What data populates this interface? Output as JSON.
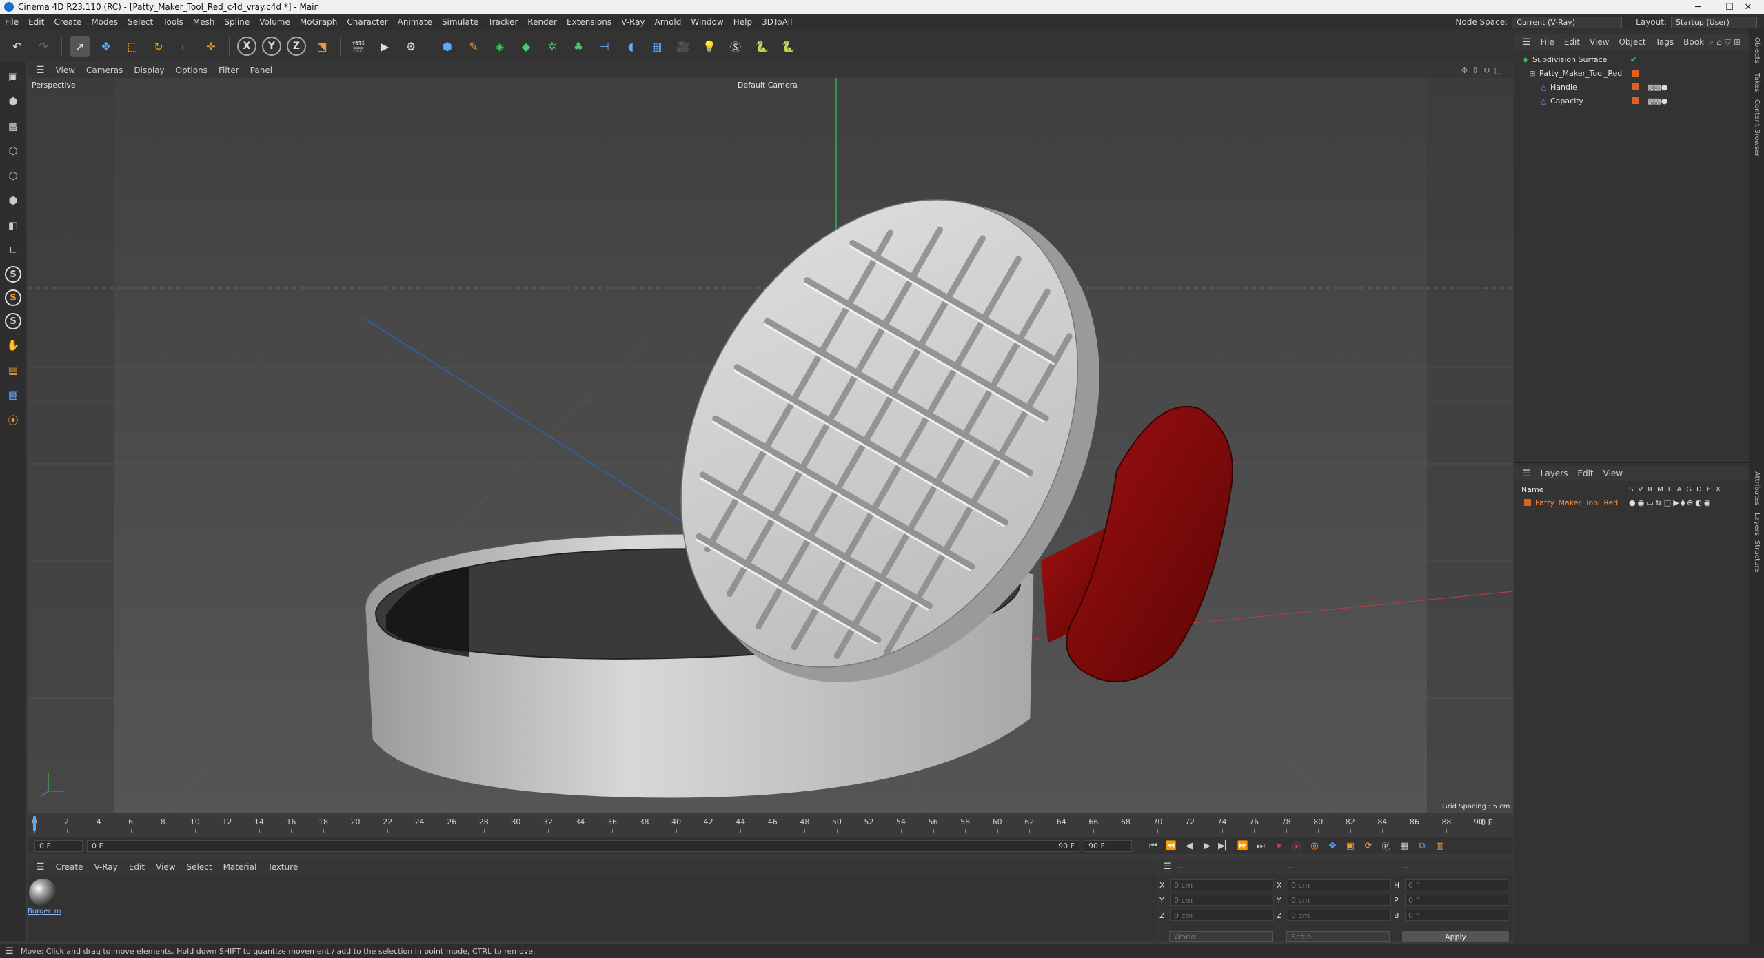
{
  "titlebar": {
    "title": "Cinema 4D R23.110 (RC) - [Patty_Maker_Tool_Red_c4d_vray.c4d *] - Main",
    "minimize": "─",
    "maximize": "☐",
    "close": "✕"
  },
  "menu": {
    "items": [
      "File",
      "Edit",
      "Create",
      "Modes",
      "Select",
      "Tools",
      "Mesh",
      "Spline",
      "Volume",
      "MoGraph",
      "Character",
      "Animate",
      "Simulate",
      "Tracker",
      "Render",
      "Extensions",
      "V-Ray",
      "Arnold",
      "Window",
      "Help",
      "3DToAll"
    ],
    "node_space_label": "Node Space:",
    "node_space_value": "Current (V-Ray)",
    "layout_label": "Layout:",
    "layout_value": "Startup (User)"
  },
  "viewport": {
    "menu": [
      "View",
      "Cameras",
      "Display",
      "Options",
      "Filter",
      "Panel"
    ],
    "view_name": "Perspective",
    "camera": "Default Camera",
    "grid_spacing": "Grid Spacing : 5 cm"
  },
  "timeline": {
    "ticks": [
      "0",
      "2",
      "4",
      "6",
      "8",
      "10",
      "12",
      "14",
      "16",
      "18",
      "20",
      "22",
      "24",
      "26",
      "28",
      "30",
      "32",
      "34",
      "36",
      "38",
      "40",
      "42",
      "44",
      "46",
      "48",
      "50",
      "52",
      "54",
      "56",
      "58",
      "60",
      "62",
      "64",
      "66",
      "68",
      "70",
      "72",
      "74",
      "76",
      "78",
      "80",
      "82",
      "84",
      "86",
      "88",
      "90"
    ],
    "current_frame_right": "0 F",
    "start_field": "0 F",
    "range_start": "0 F",
    "range_end": "90 F",
    "end_field": "90 F"
  },
  "material_manager": {
    "menu": [
      "Create",
      "V-Ray",
      "Edit",
      "View",
      "Select",
      "Material",
      "Texture"
    ],
    "materials": [
      {
        "name": "Burger_m"
      }
    ]
  },
  "coordinates": {
    "header_left": "--",
    "header_mid": "--",
    "header_right": "--",
    "rows": [
      {
        "a": "X",
        "av": "0 cm",
        "b": "X",
        "bv": "0 cm",
        "c": "H",
        "cv": "0 °"
      },
      {
        "a": "Y",
        "av": "0 cm",
        "b": "Y",
        "bv": "0 cm",
        "c": "P",
        "cv": "0 °"
      },
      {
        "a": "Z",
        "av": "0 cm",
        "b": "Z",
        "bv": "0 cm",
        "c": "B",
        "cv": "0 °"
      }
    ],
    "mode1": "World",
    "mode2": "Scale",
    "apply": "Apply"
  },
  "object_manager": {
    "menu": [
      "File",
      "Edit",
      "View",
      "Object",
      "Tags",
      "Book"
    ],
    "objects": [
      {
        "name": "Subdivision Surface"
      },
      {
        "name": "Patty_Maker_Tool_Red"
      },
      {
        "name": "Handle"
      },
      {
        "name": "Capacity"
      }
    ]
  },
  "layer_manager": {
    "menu": [
      "Layers",
      "Edit",
      "View"
    ],
    "name_header": "Name",
    "flags": [
      "S",
      "V",
      "R",
      "M",
      "L",
      "A",
      "G",
      "D",
      "E",
      "X"
    ],
    "layers": [
      {
        "name": "Patty_Maker_Tool_Red"
      }
    ]
  },
  "side_tabs": [
    "Objects",
    "Takes",
    "Content Browser",
    "Attributes",
    "Layers",
    "Structure"
  ],
  "status": "Move: Click and drag to move elements. Hold down SHIFT to quantize movement / add to the selection in point mode, CTRL to remove.",
  "colors": {
    "accent": "#e06020",
    "handle_red": "#8a0a0a",
    "body_grey": "#c8c8c8"
  }
}
